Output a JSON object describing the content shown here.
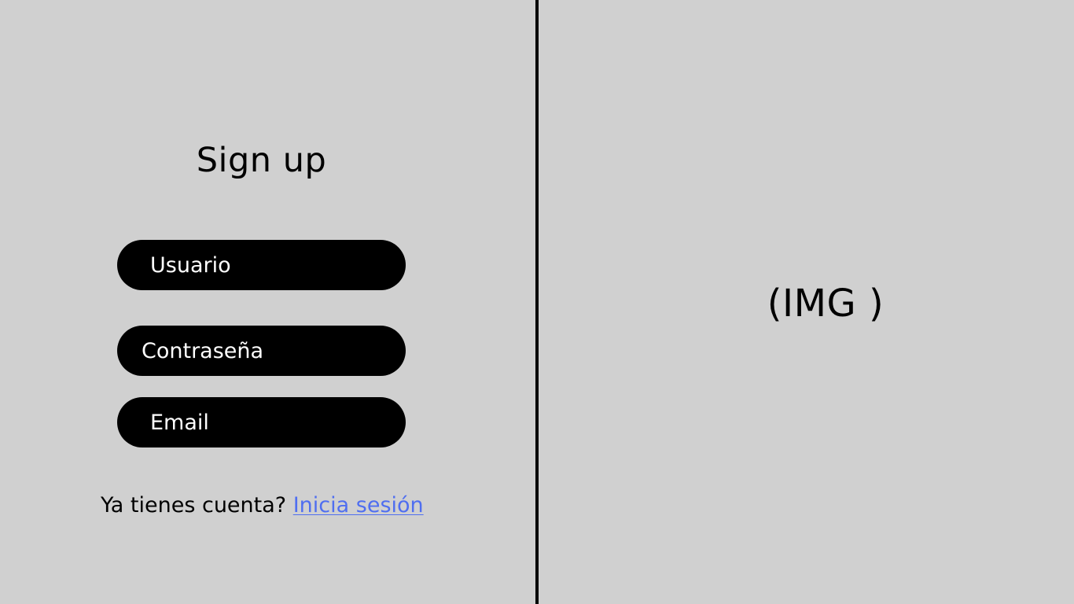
{
  "signup": {
    "title": "Sign up",
    "fields": {
      "username_placeholder": "Usuario",
      "password_placeholder": "Contraseña",
      "email_placeholder": "Email"
    },
    "account_prompt": "Ya tienes cuenta?",
    "login_link": "Inicia sesión"
  },
  "image_panel": {
    "placeholder_text": "(IMG )"
  },
  "colors": {
    "background": "#d0d0d0",
    "field_background": "#000000",
    "field_text": "#ffffff",
    "link": "#4f6ef0",
    "divider": "#000000"
  }
}
